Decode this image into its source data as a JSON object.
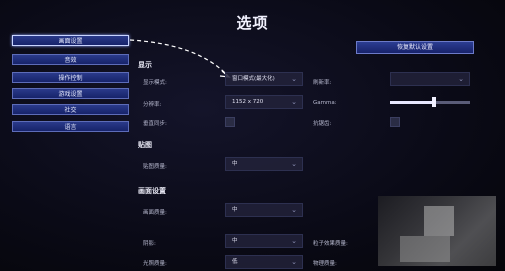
{
  "title": "选项",
  "nav": [
    {
      "label": "画面设置",
      "active": true
    },
    {
      "label": "音效",
      "active": false
    },
    {
      "label": "操作控制",
      "active": false
    },
    {
      "label": "游戏设置",
      "active": false
    },
    {
      "label": "社交",
      "active": false
    },
    {
      "label": "语言",
      "active": false
    }
  ],
  "reset_button": "恢复默认设置",
  "display": {
    "section": "显示",
    "mode_label": "显示模式:",
    "mode_value": "窗口模式(最大化)",
    "resolution_label": "分辨率:",
    "resolution_value": "1152 x 720",
    "vsync_label": "垂直同步:",
    "refresh_label": "刷新率:",
    "refresh_value": "",
    "gamma_label": "Gamma:",
    "gamma_level": 0.55,
    "aa_label": "抗锯齿:"
  },
  "texture": {
    "section": "贴图",
    "quality_label": "贴图质量:",
    "quality_value": "中"
  },
  "graphics": {
    "section": "画面设置",
    "quality_label": "画面质量:",
    "quality_value": "中",
    "shadow_label": "阴影:",
    "shadow_value": "中",
    "particle_label": "粒子效果质量:",
    "light_label": "光照质量:",
    "light_value": "低",
    "physics_label": "物理质量:"
  }
}
